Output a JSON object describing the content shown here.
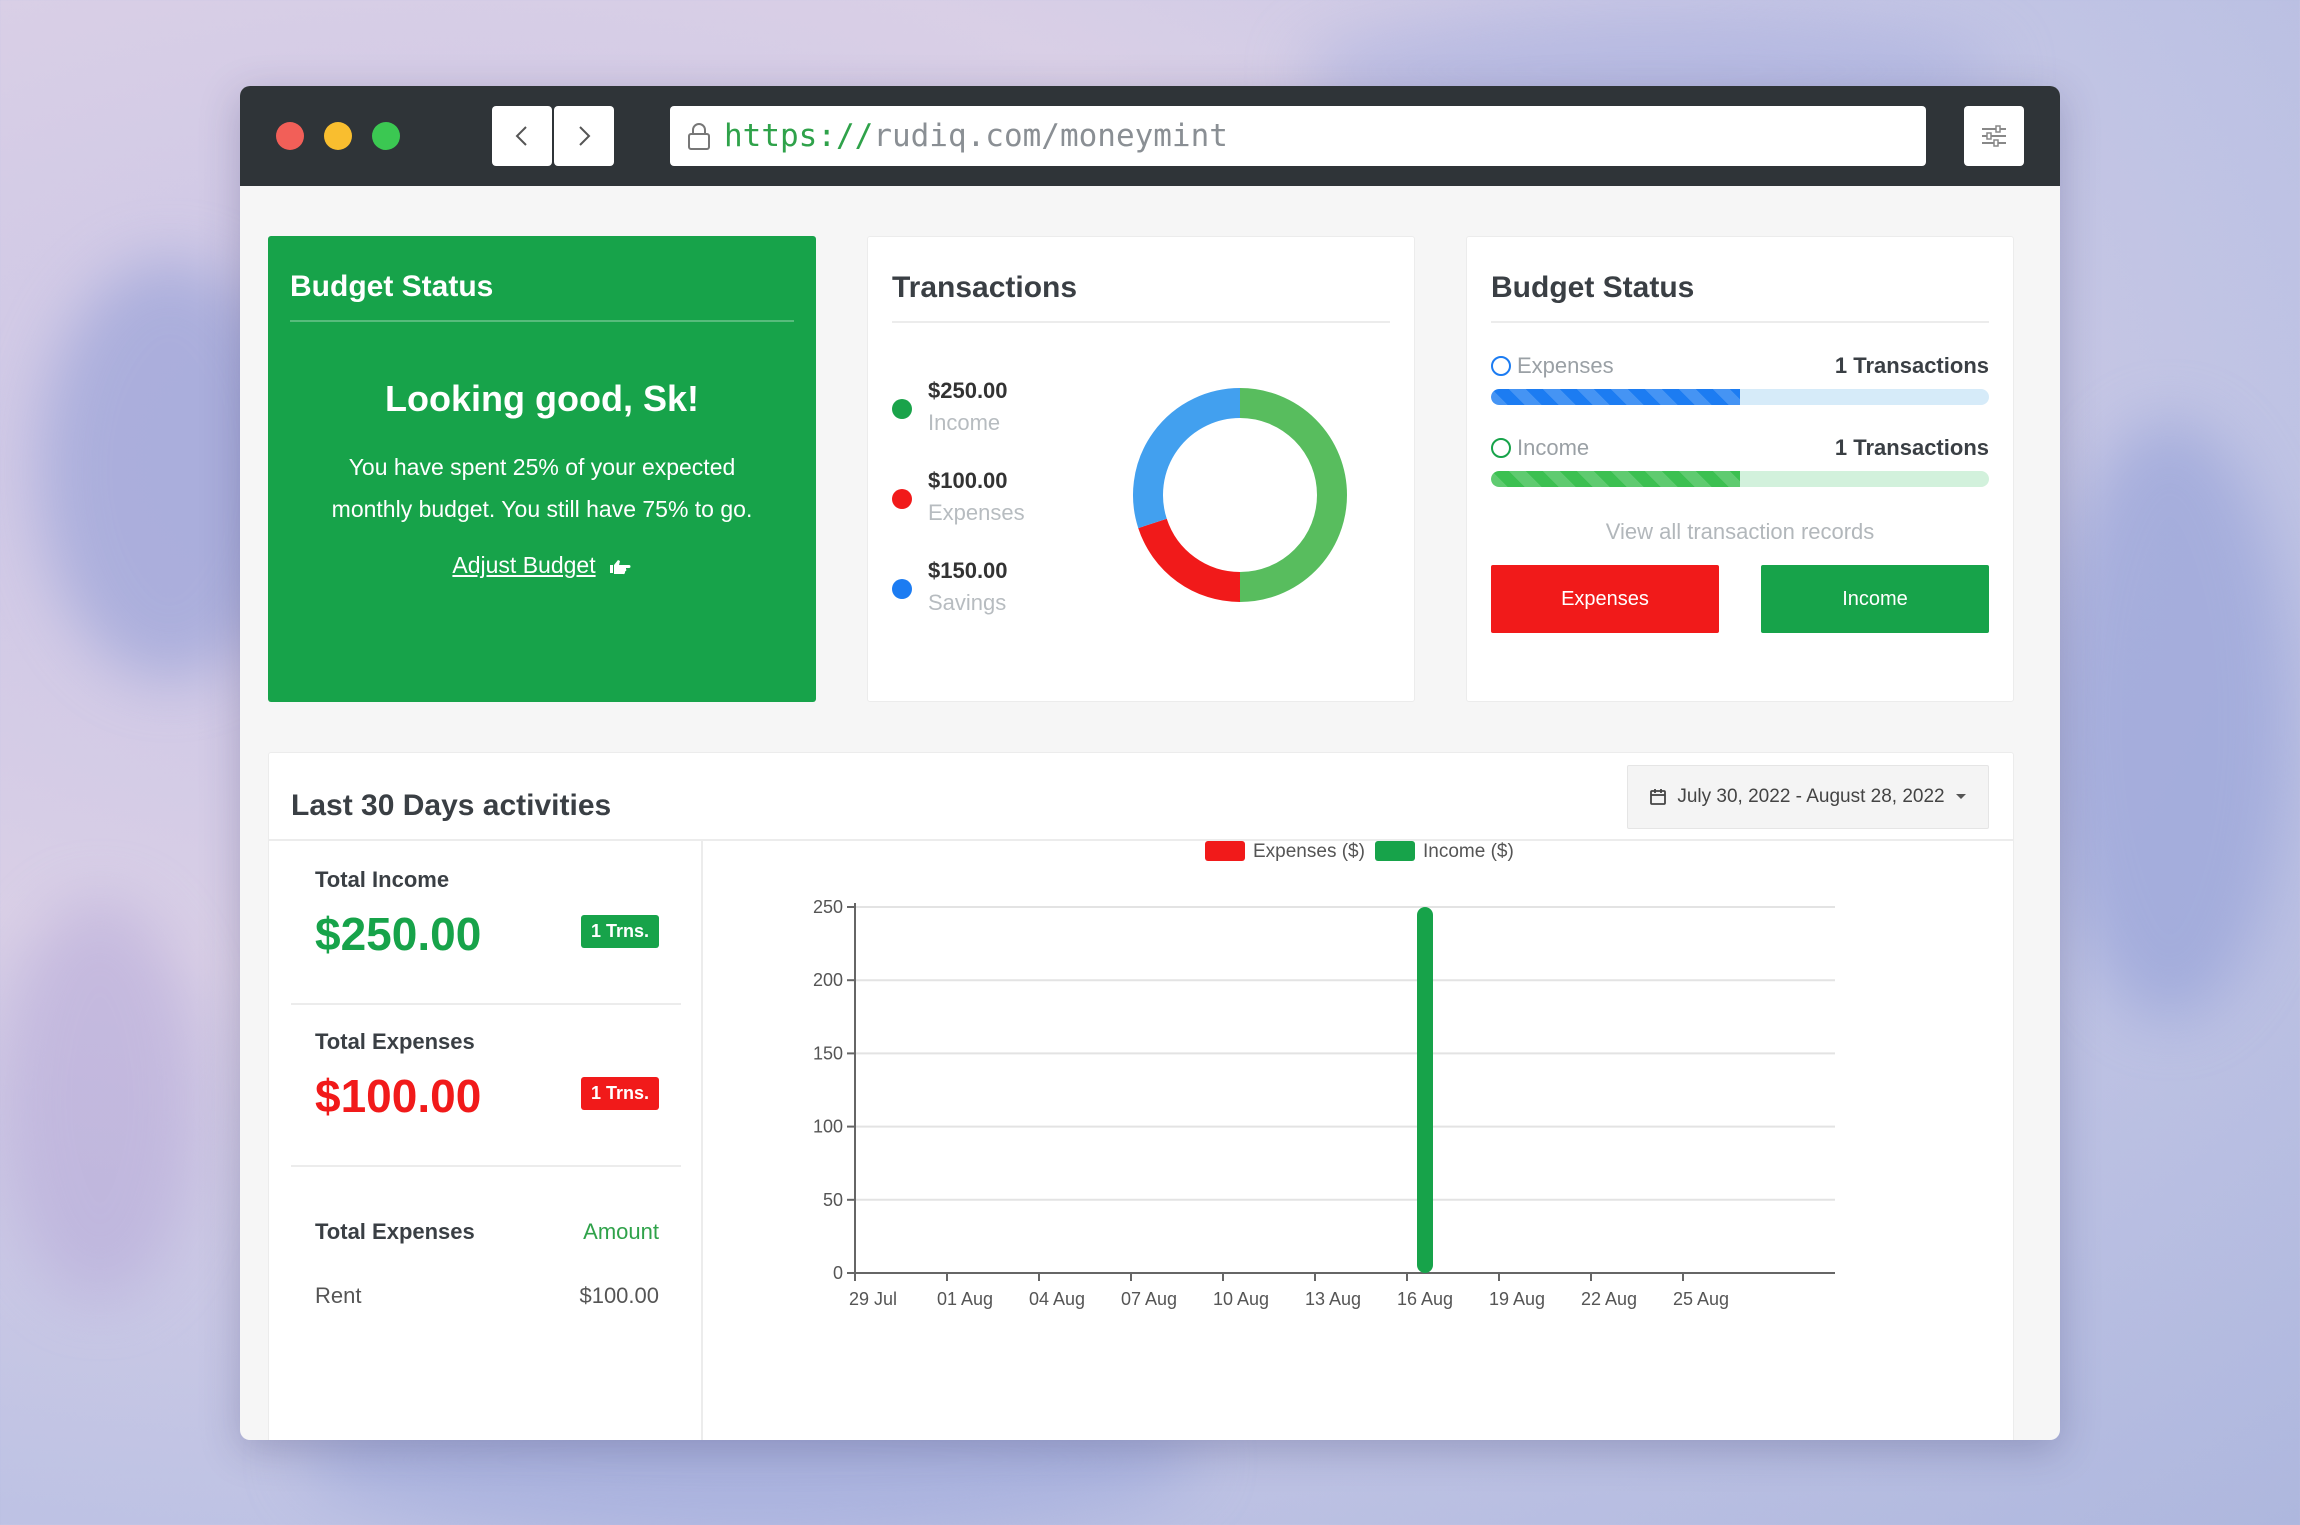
{
  "browser": {
    "url_scheme": "https://",
    "url_rest": "rudiq.com/moneymint"
  },
  "budget_card": {
    "title": "Budget Status",
    "headline": "Looking good, Sk!",
    "message_line1": "You have spent 25% of your expected",
    "message_line2": "monthly budget. You still have 75% to go.",
    "adjust_label": "Adjust Budget"
  },
  "transactions_card": {
    "title": "Transactions",
    "items": [
      {
        "amount": "$250.00",
        "label": "Income",
        "color": "#1aa34a"
      },
      {
        "amount": "$100.00",
        "label": "Expenses",
        "color": "#f11a1a"
      },
      {
        "amount": "$150.00",
        "label": "Savings",
        "color": "#1c7cf2"
      }
    ],
    "donut": [
      {
        "name": "Income",
        "value": 250,
        "color": "#58bd5e"
      },
      {
        "name": "Expenses",
        "value": 100,
        "color": "#f11a1a"
      },
      {
        "name": "Savings",
        "value": 150,
        "color": "#42a0ef"
      }
    ]
  },
  "status_card": {
    "title": "Budget Status",
    "expenses_label": "Expenses",
    "expenses_count": "1 Transactions",
    "expenses_progress": 0.5,
    "income_label": "Income",
    "income_count": "1 Transactions",
    "income_progress": 0.5,
    "view_all": "View all transaction records",
    "btn_expenses": "Expenses",
    "btn_income": "Income"
  },
  "activity": {
    "title": "Last 30 Days activities",
    "date_range": "July 30, 2022 - August 28, 2022",
    "total_income_label": "Total Income",
    "total_income_value": "$250.00",
    "total_income_badge": "1 Trns.",
    "total_expenses_label": "Total Expenses",
    "total_expenses_value": "$100.00",
    "total_expenses_badge": "1 Trns.",
    "table_header_left": "Total Expenses",
    "table_header_right": "Amount",
    "table_rows": [
      {
        "name": "Rent",
        "amount": "$100.00"
      }
    ]
  },
  "colors": {
    "green": "#17a34a",
    "red": "#f11a1a",
    "blue": "#1c7cf2"
  },
  "chart_data": {
    "type": "bar",
    "legend": [
      "Expenses ($)",
      "Income ($)"
    ],
    "legend_colors": [
      "#f11a1a",
      "#17a34a"
    ],
    "x_ticks": [
      "29 Jul",
      "01 Aug",
      "04 Aug",
      "07 Aug",
      "10 Aug",
      "13 Aug",
      "16 Aug",
      "19 Aug",
      "22 Aug",
      "25 Aug"
    ],
    "y_ticks": [
      0,
      50,
      100,
      150,
      200,
      250
    ],
    "ylim": [
      0,
      250
    ],
    "x_range_days": [
      "2022-07-29",
      "2022-08-28"
    ],
    "series": [
      {
        "name": "Expenses ($)",
        "points": []
      },
      {
        "name": "Income ($)",
        "points": [
          {
            "x": "2022-08-16",
            "y": 250
          }
        ]
      }
    ]
  }
}
